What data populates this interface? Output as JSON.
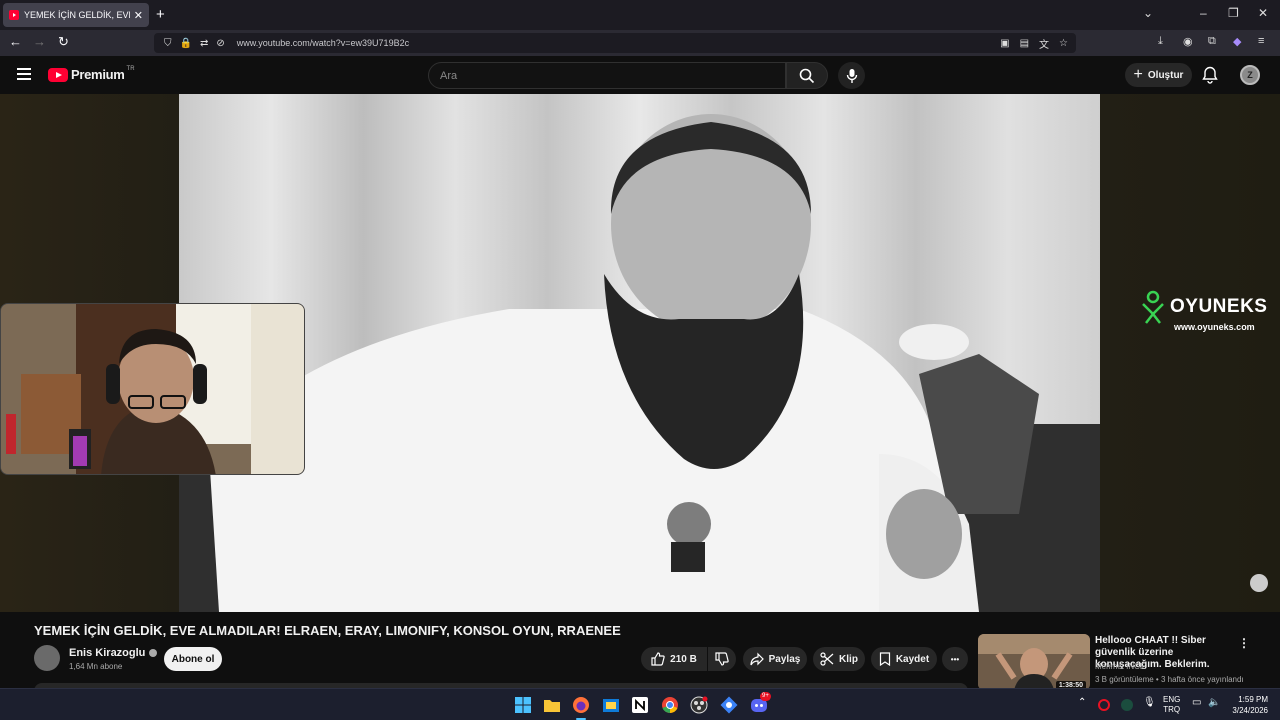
{
  "browser": {
    "tab_title": "YEMEK İÇİN GELDİK, EVE ALMADILAR!",
    "tab_close": "✕",
    "new_tab": "+",
    "url": "www.youtube.com/watch?v=ew39U719B2c",
    "window_controls": [
      "⌄",
      "–",
      "❐",
      "✕"
    ]
  },
  "yt_header": {
    "logo_text": "Premium",
    "region": "TR",
    "search_placeholder": "Ara",
    "create_label": "Oluştur",
    "avatar_initial": "Z"
  },
  "video": {
    "overlay_brand": "OYUNEKS",
    "overlay_site": "www.oyuneks.com"
  },
  "watch": {
    "title": "YEMEK İÇİN GELDİK, EVE ALMADILAR! ELRAEN, ERAY, LIMONIFY, KONSOL OYUN, RRAENEE",
    "channel": "Enis Kirazoglu",
    "subscribers": "1,64 Mn abone",
    "subscribe_label": "Abone ol",
    "likes": "210 B",
    "share_label": "Paylaş",
    "clip_label": "Klip",
    "save_label": "Kaydet",
    "more_label": "•••"
  },
  "recommendation": {
    "title": "Hellooo CHAAT !! Siber güvenlik üzerine konuşacağım. Beklerim.",
    "channel": "Mehmet INCE",
    "meta": "3 B görüntüleme • 3 hafta önce yayınlandı",
    "duration": "1:38:50",
    "more": "⋮"
  },
  "taskbar": {
    "lang_top": "ENG",
    "lang_bottom": "TRQ",
    "time": "1:59 PM",
    "date": "3/24/2026",
    "discord_badge": "9+",
    "tray_chevron": "⌃"
  },
  "colors": {
    "yt_red": "#ff0033",
    "bg": "#0f0f0f",
    "oyuneks_green": "#39d353"
  }
}
